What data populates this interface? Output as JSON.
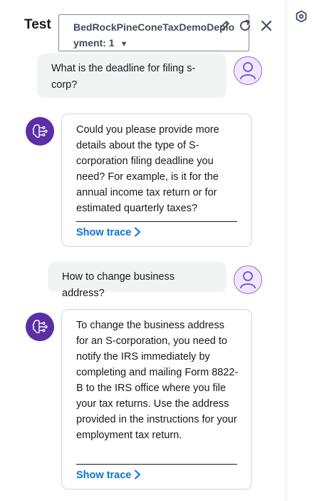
{
  "panel": {
    "title": "Test"
  },
  "agent_select": {
    "value": "BedRockPineConeTaxDemoDeployment: 1"
  },
  "messages": [
    {
      "role": "user",
      "text": "What is the deadline for filing s-corp?"
    },
    {
      "role": "bot",
      "text": "Could you please provide more details about the type of S-corporation filing deadline you need? For example, is it for the annual income tax return or for estimated quarterly taxes?",
      "trace_label": "Show trace"
    },
    {
      "role": "user",
      "text": "How to change business address?"
    },
    {
      "role": "bot",
      "text": "To change the business address for an S-corporation, you need to notify the IRS immediately by completing and mailing Form 8822-B to the IRS office where you file your tax returns. Use the address provided in the instructions for your employment tax return.",
      "trace_label": "Show trace"
    }
  ],
  "icons": {
    "edit": "pencil-icon",
    "refresh": "refresh-icon",
    "close": "close-icon",
    "user": "user-avatar-icon",
    "bot": "brain-circuit-icon",
    "strip": "settings-hexagon-icon"
  },
  "colors": {
    "link": "#0972d3",
    "bot_avatar": "#5b2ea6",
    "user_avatar_bg": "#efe7ff",
    "user_bubble": "#f2f3f3"
  }
}
